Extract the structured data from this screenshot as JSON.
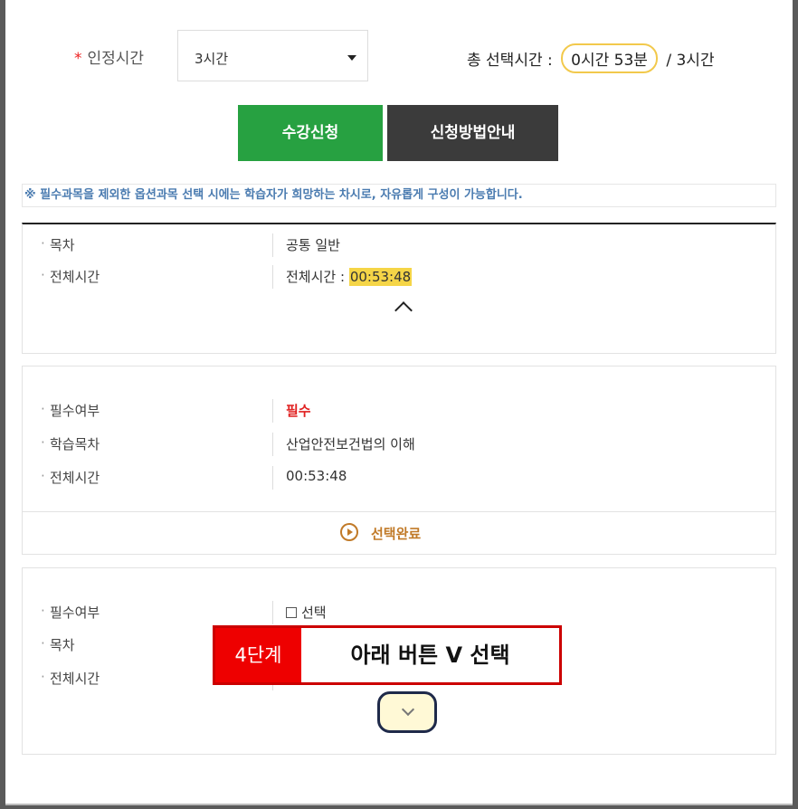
{
  "form": {
    "required_star": "*",
    "cert_time_label": "인정시간",
    "cert_time_value": "3시간",
    "total_label": "총 선택시간 :",
    "total_selected": "0시간 53분",
    "total_sep": "/",
    "total_max": "3시간"
  },
  "buttons": {
    "apply": "수강신청",
    "guide": "신청방법안내"
  },
  "notice": "※ 필수과목을 제외한 옵션과목 선택 시에는 학습자가 희망하는 차시로, 자유롭게 구성이 가능합니다.",
  "panel1": {
    "toc_label": "목차",
    "toc_value": "공통 일반",
    "time_label": "전체시간",
    "time_prefix": "전체시간 :",
    "time_value": "00:53:48"
  },
  "panel2": {
    "required_label": "필수여부",
    "required_value": "필수",
    "topic_label": "학습목차",
    "topic_value": "산업안전보건법의 이해",
    "time_label": "전체시간",
    "time_value": "00:53:48",
    "done_label": "선택완료"
  },
  "panel3": {
    "required_label": "필수여부",
    "select_label": "선택",
    "toc_label": "목차",
    "time_label": "전체시간"
  },
  "callout": {
    "step": "4단계",
    "message": "아래 버튼 V 선택"
  },
  "icons": {
    "dropdown": "caret-down-icon",
    "collapse": "chevron-up-icon",
    "expand": "chevron-down-icon",
    "done": "play-circle-icon"
  },
  "colors": {
    "apply_button": "#27a141",
    "guide_button": "#3b3b3b",
    "highlight": "#f5d547",
    "callout_red": "#e00000"
  }
}
